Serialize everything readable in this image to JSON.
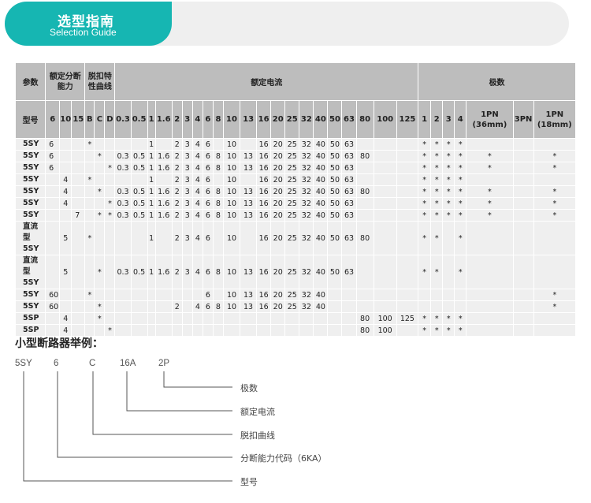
{
  "header": {
    "title": "选型指南",
    "subtitle": "Selection Guide"
  },
  "table": {
    "group_headers": {
      "param": "参数",
      "breaking": "额定分断能力",
      "curve": "脱扣特性曲线",
      "current": "额定电流",
      "poles": "极数"
    },
    "subheaders": {
      "model": "型号",
      "breaking": [
        "6",
        "10",
        "15"
      ],
      "curve": [
        "B",
        "C",
        "D"
      ],
      "current": [
        "0.3",
        "0.5",
        "1",
        "1.6",
        "2",
        "3",
        "4",
        "6",
        "8",
        "10",
        "13",
        "16",
        "20",
        "25",
        "32",
        "40",
        "50",
        "63",
        "80",
        "100",
        "125"
      ],
      "poles": [
        "1",
        "2",
        "3",
        "4",
        "1PN (36mm)",
        "3PN",
        "1PN (18mm)"
      ]
    },
    "rows": [
      [
        "5SY",
        "6",
        "",
        "",
        "*",
        "",
        "",
        "",
        "",
        "1",
        "",
        "2",
        "3",
        "4",
        "6",
        "",
        "10",
        "",
        "16",
        "20",
        "25",
        "32",
        "40",
        "50",
        "63",
        "",
        "",
        "",
        "*",
        "*",
        "*",
        "*",
        "",
        "",
        ""
      ],
      [
        "5SY",
        "6",
        "",
        "",
        "",
        "*",
        "",
        "0.3",
        "0.5",
        "1",
        "1.6",
        "2",
        "3",
        "4",
        "6",
        "8",
        "10",
        "13",
        "16",
        "20",
        "25",
        "32",
        "40",
        "50",
        "63",
        "80",
        "",
        "",
        "*",
        "*",
        "*",
        "*",
        "*",
        "",
        "*"
      ],
      [
        "5SY",
        "6",
        "",
        "",
        "",
        "",
        "*",
        "0.3",
        "0.5",
        "1",
        "1.6",
        "2",
        "3",
        "4",
        "6",
        "8",
        "10",
        "13",
        "16",
        "20",
        "25",
        "32",
        "40",
        "50",
        "63",
        "",
        "",
        "",
        "*",
        "*",
        "*",
        "*",
        "*",
        "",
        "*"
      ],
      [
        "5SY",
        "",
        "4",
        "",
        "*",
        "",
        "",
        "",
        "",
        "1",
        "",
        "2",
        "3",
        "4",
        "6",
        "",
        "10",
        "",
        "16",
        "20",
        "25",
        "32",
        "40",
        "50",
        "63",
        "",
        "",
        "",
        "*",
        "*",
        "*",
        "*",
        "",
        "",
        ""
      ],
      [
        "5SY",
        "",
        "4",
        "",
        "",
        "*",
        "",
        "0.3",
        "0.5",
        "1",
        "1.6",
        "2",
        "3",
        "4",
        "6",
        "8",
        "10",
        "13",
        "16",
        "20",
        "25",
        "32",
        "40",
        "50",
        "63",
        "80",
        "",
        "",
        "*",
        "*",
        "*",
        "*",
        "*",
        "",
        "*"
      ],
      [
        "5SY",
        "",
        "4",
        "",
        "",
        "",
        "*",
        "0.3",
        "0.5",
        "1",
        "1.6",
        "2",
        "3",
        "4",
        "6",
        "8",
        "10",
        "13",
        "16",
        "20",
        "25",
        "32",
        "40",
        "50",
        "63",
        "",
        "",
        "",
        "*",
        "*",
        "*",
        "*",
        "*",
        "",
        "*"
      ],
      [
        "5SY",
        "",
        "",
        "7",
        "",
        "*",
        "*",
        "0.3",
        "0.5",
        "1",
        "1.6",
        "2",
        "3",
        "4",
        "6",
        "8",
        "10",
        "13",
        "16",
        "20",
        "25",
        "32",
        "40",
        "50",
        "63",
        "",
        "",
        "",
        "*",
        "*",
        "*",
        "*",
        "*",
        "",
        "*"
      ],
      [
        "直流型 5SY",
        "",
        "5",
        "",
        "*",
        "",
        "",
        "",
        "",
        "1",
        "",
        "2",
        "3",
        "4",
        "6",
        "",
        "10",
        "",
        "16",
        "20",
        "25",
        "32",
        "40",
        "50",
        "63",
        "80",
        "",
        "",
        "*",
        "*",
        "",
        "*",
        "",
        "",
        ""
      ],
      [
        "直流型 5SY",
        "",
        "5",
        "",
        "",
        "*",
        "",
        "0.3",
        "0.5",
        "1",
        "1.6",
        "2",
        "3",
        "4",
        "6",
        "8",
        "10",
        "13",
        "16",
        "20",
        "25",
        "32",
        "40",
        "50",
        "63",
        "",
        "",
        "",
        "*",
        "*",
        "",
        "*",
        "",
        "",
        ""
      ],
      [
        "5SY",
        "60",
        "",
        "",
        "*",
        "",
        "",
        "",
        "",
        "",
        "",
        "",
        "",
        "",
        "6",
        "",
        "10",
        "13",
        "16",
        "20",
        "25",
        "32",
        "40",
        "",
        "",
        "",
        "",
        "",
        "",
        "",
        "",
        "",
        "",
        "",
        "*"
      ],
      [
        "5SY",
        "60",
        "",
        "",
        "",
        "*",
        "",
        "",
        "",
        "",
        "",
        "2",
        "",
        "4",
        "6",
        "8",
        "10",
        "13",
        "16",
        "20",
        "25",
        "32",
        "40",
        "",
        "",
        "",
        "",
        "",
        "",
        "",
        "",
        "",
        "",
        "",
        "*"
      ],
      [
        "5SP",
        "",
        "4",
        "",
        "",
        "*",
        "",
        "",
        "",
        "",
        "",
        "",
        "",
        "",
        "",
        "",
        "",
        "",
        "",
        "",
        "",
        "",
        "",
        "",
        "",
        "80",
        "100",
        "125",
        "*",
        "*",
        "*",
        "*",
        "",
        "",
        ""
      ],
      [
        "5SP",
        "",
        "4",
        "",
        "",
        "",
        "*",
        "",
        "",
        "",
        "",
        "",
        "",
        "",
        "",
        "",
        "",
        "",
        "",
        "",
        "",
        "",
        "",
        "",
        "",
        "80",
        "100",
        "",
        "*",
        "*",
        "*",
        "*",
        "",
        "",
        ""
      ]
    ]
  },
  "example": {
    "title": "小型断路器举例：",
    "codes": [
      "5SY",
      "6",
      "C",
      "16A",
      "2P"
    ],
    "labels": [
      "极数",
      "额定电流",
      "脱扣曲线",
      "分断能力代码（6KA）",
      "型号"
    ]
  }
}
